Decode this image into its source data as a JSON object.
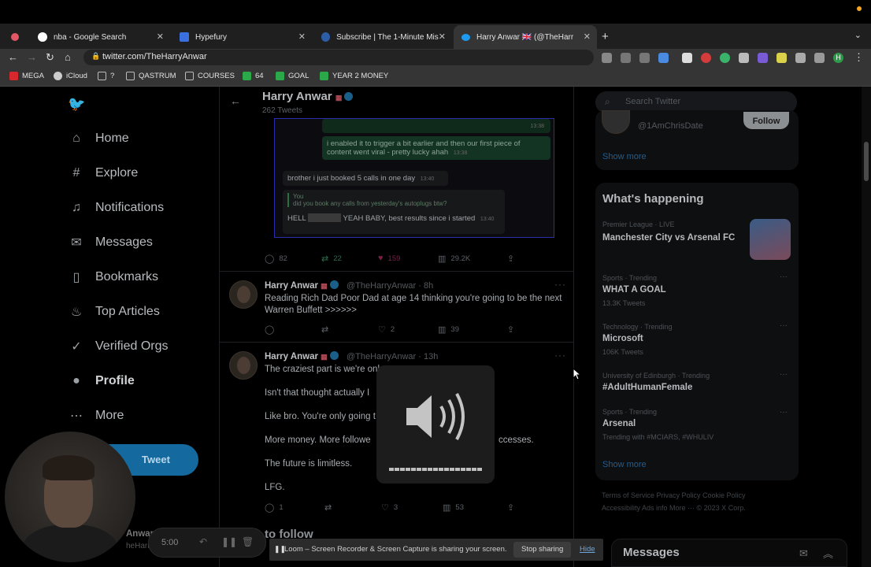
{
  "browser": {
    "tabs": [
      {
        "title": "nba - Google Search",
        "fav_color": "#ffffff"
      },
      {
        "title": "Hypefury",
        "fav_color": "#3a6fe0"
      },
      {
        "title": "Subscribe | The 1-Minute Missi",
        "fav_color": "#2c5ea8"
      },
      {
        "title": "Harry Anwar 🇬🇧 (@TheHarr",
        "fav_color": "#1d9bf0"
      }
    ],
    "url": "twitter.com/TheHarryAnwar",
    "bookmarks": [
      "MEGA",
      "iCloud",
      "?",
      "QASTRUM",
      "COURSES",
      "64",
      "GOAL",
      "YEAR 2 MONEY"
    ],
    "profile_initial": "H"
  },
  "sidebar": {
    "items": [
      {
        "label": "Home",
        "icon": "home-icon"
      },
      {
        "label": "Explore",
        "icon": "hashtag-icon"
      },
      {
        "label": "Notifications",
        "icon": "bell-icon"
      },
      {
        "label": "Messages",
        "icon": "envelope-icon"
      },
      {
        "label": "Bookmarks",
        "icon": "bookmark-icon"
      },
      {
        "label": "Top Articles",
        "icon": "flame-icon"
      },
      {
        "label": "Verified Orgs",
        "icon": "check-badge-icon"
      },
      {
        "label": "Profile",
        "icon": "person-icon"
      },
      {
        "label": "More",
        "icon": "more-circle-icon"
      }
    ],
    "tweet_button": "Tweet"
  },
  "profile": {
    "name": "Harry Anwar",
    "tweet_count": "262 Tweets"
  },
  "dm_screenshot": {
    "msg1": "i enabled it to trigger a bit earlier and then our first piece of content went viral - pretty lucky ahah",
    "msg1_time": "13:38",
    "msg2": "brother i just booked 5 calls in one day",
    "msg2_time": "13:40",
    "quote_from": "You",
    "quote_text": "did you book any calls from yesterday's autoplugs btw?",
    "msg3_a": "HELL",
    "msg3_b": "YEAH BABY, best results since i started",
    "msg3_time": "13:40",
    "stats": {
      "replies": "82",
      "retweets": "22",
      "likes": "159",
      "views": "29.2K"
    }
  },
  "tweets": [
    {
      "name": "Harry Anwar",
      "handle": "@TheHarryAnwar · 8h",
      "text": "Reading Rich Dad Poor Dad at age 14 thinking you're going to be the next Warren Buffett  >>>>>>",
      "stats": {
        "replies": "",
        "retweets": "",
        "likes": "2",
        "views": "39"
      }
    },
    {
      "name": "Harry Anwar",
      "handle": "@TheHarryAnwar · 13h",
      "lines": [
        "The craziest part is we're onl",
        "Isn't that thought actually I",
        "Like bro. You're only going t",
        "More money. More followe",
        "The future is limitless.",
        "LFG."
      ],
      "line4_tail": "ccesses.",
      "stats": {
        "replies": "1",
        "retweets": "",
        "likes": "3",
        "views": "53"
      }
    }
  ],
  "right": {
    "search_placeholder": "Search Twitter",
    "follow_handle": "@1AmChrisDate",
    "follow_button": "Follow",
    "show_more": "Show more",
    "happening_title": "What's happening",
    "trends": [
      {
        "label": "Premier League · LIVE",
        "title": "Manchester City vs Arsenal FC",
        "meta": ""
      },
      {
        "label": "Sports · Trending",
        "title": "WHAT A GOAL",
        "meta": "13.3K Tweets"
      },
      {
        "label": "Technology · Trending",
        "title": "Microsoft",
        "meta": "106K Tweets"
      },
      {
        "label": "University of Edinburgh · Trending",
        "title": "#AdultHumanFemale",
        "meta": ""
      },
      {
        "label": "Sports · Trending",
        "title": "Arsenal",
        "meta": "Trending with #MCIARS, #WHULIV"
      }
    ],
    "show_more_2": "Show more",
    "footer_1": "Terms of Service   Privacy Policy   Cookie Policy",
    "footer_2": "Accessibility   Ads info   More ···   © 2023 X Corp.",
    "messages_title": "Messages"
  },
  "loom": {
    "timer": "5:00",
    "share_message": "Loom – Screen Recorder & Screen Capture is sharing your screen.",
    "stop_label": "Stop sharing",
    "hide_label": "Hide"
  },
  "partial_follow": "to follow",
  "partial_anwar": "Anwar",
  "partial_handle": "heHarry"
}
